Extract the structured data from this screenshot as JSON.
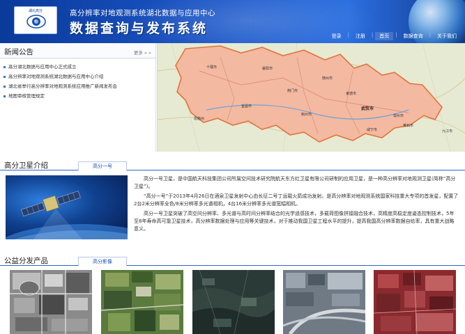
{
  "header": {
    "logo_text": "湖北高分",
    "subtitle": "高分辨率对地观测系统湖北数据与应用中心",
    "title": "数据查询与发布系统",
    "nav": [
      {
        "label": "登录"
      },
      {
        "label": "注册"
      },
      {
        "label": "首页"
      },
      {
        "label": "数据查询"
      },
      {
        "label": "关于我们"
      }
    ]
  },
  "news": {
    "title": "新闻公告",
    "more": "更多 » »",
    "items": [
      "高分湖北数据与应用中心正式成立",
      "高分辨率对地观测系统湖北数据与应用中心介绍",
      "湖北省举行高分辨率对地观测系统应用推广新闻发布会",
      "地图审核管理规定"
    ]
  },
  "map": {
    "labels": [
      "十堰市",
      "襄阳市",
      "随州市",
      "孝感市",
      "荆门市",
      "恩施州",
      "宜昌市",
      "荆州市",
      "武汉市",
      "鄂州市",
      "黄石市",
      "咸宁市",
      "九江市"
    ]
  },
  "satellite": {
    "title": "高分卫星介绍",
    "tab": "高分一号",
    "paragraphs": [
      "高分一号卫星，是中国航天科技集团公司所属空间技术研究院航天东方红卫星有限公司研制的应用卫星，是一种高分辨率对地观测卫星(简称“高分卫星”)。",
      "“高分一号”于2013年4月26日在酒泉卫星发射中心由长征二号丁运载火箭成功发射。是高分辨率对地观测系统国家科技重大专项的首发星，配置了2台2米分辨率全色/8米分辨率多光谱相机，4台16米分辨率多光谱宽幅相机。",
      "高分一号卫星突破了高空间分辨率、多光谱与高时间分辨率结合的光学遥感技术，多载荷图像拼接融合技术，高精度高稳定度姿态控制技术，5年至8年寿命高可靠卫星技术，高分辨率数据处理与应用等关键技术，对于推动我国卫星工程水平的提升，提高我国高分辨率数据自给率，具有重大战略意义。"
    ]
  },
  "products": {
    "title": "公益分发产品",
    "tab": "高分影像"
  },
  "colors": {
    "header_blue": "#1b55c6",
    "accent_blue": "#2f63c4",
    "province_fill": "#f3b9a1",
    "province_border": "#e0743d"
  }
}
